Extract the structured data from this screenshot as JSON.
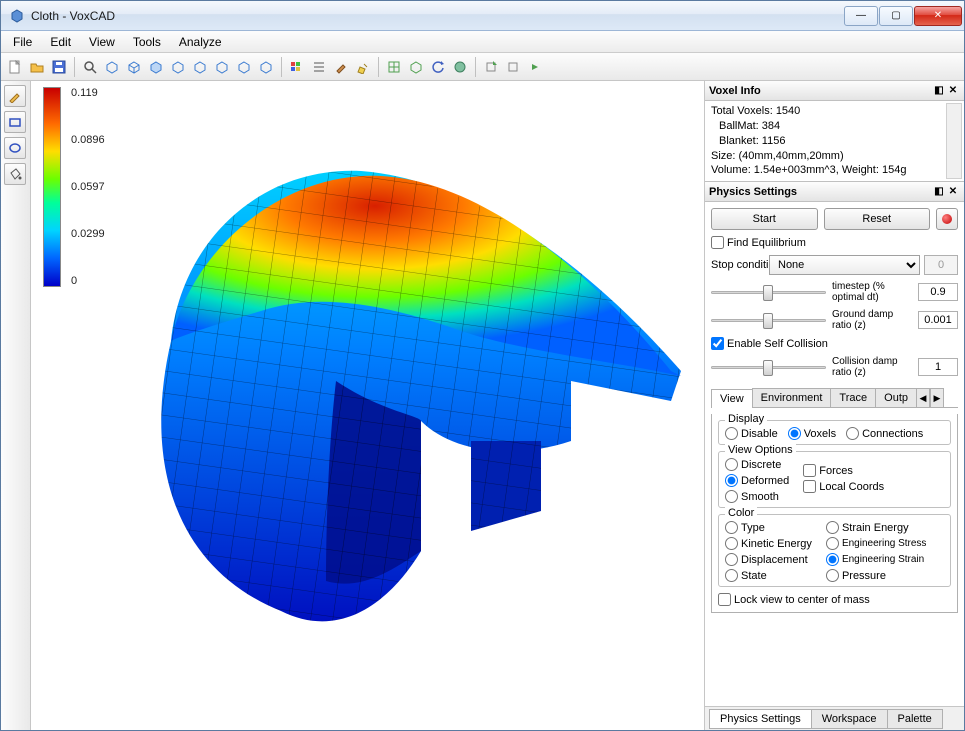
{
  "window": {
    "title": "Cloth - VoxCAD"
  },
  "menu": {
    "file": "File",
    "edit": "Edit",
    "view": "View",
    "tools": "Tools",
    "analyze": "Analyze"
  },
  "legend": {
    "v0": "0.119",
    "v1": "0.0896",
    "v2": "0.0597",
    "v3": "0.0299",
    "v4": "0"
  },
  "voxinfo": {
    "title": "Voxel Info",
    "line1": "Total Voxels: 1540",
    "line2": "BallMat: 384",
    "line3": "Blanket: 1156",
    "line4": "Size: (40mm,40mm,20mm)",
    "line5": "Volume: 1.54e+003mm^3, Weight: 154g"
  },
  "physics": {
    "title": "Physics Settings",
    "start": "Start",
    "reset": "Reset",
    "findeq": "Find Equilibrium",
    "stopcond_lbl": "Stop condition",
    "stopcond_val": "None",
    "stopcond_num": "0",
    "timestep_lbl": "timestep (% optimal dt)",
    "timestep_val": "0.9",
    "grounddamp_lbl": "Ground damp ratio (z)",
    "grounddamp_val": "0.001",
    "selfcol": "Enable Self Collision",
    "coldamp_lbl": "Collision damp ratio (z)",
    "coldamp_val": "1",
    "tabs": {
      "view": "View",
      "env": "Environment",
      "trace": "Trace",
      "out": "Outp"
    },
    "display": {
      "title": "Display",
      "disable": "Disable",
      "voxels": "Voxels",
      "connections": "Connections"
    },
    "viewopts": {
      "title": "View Options",
      "discrete": "Discrete",
      "deformed": "Deformed",
      "smooth": "Smooth",
      "forces": "Forces",
      "localcoords": "Local Coords"
    },
    "color": {
      "title": "Color",
      "type": "Type",
      "kinetic": "Kinetic Energy",
      "displacement": "Displacement",
      "state": "State",
      "strainenergy": "Strain Energy",
      "engstress": "Engineering Stress",
      "engstrain": "Engineering Strain",
      "pressure": "Pressure"
    },
    "lockview": "Lock view to center of mass"
  },
  "bottomtabs": {
    "physics": "Physics Settings",
    "workspace": "Workspace",
    "palette": "Palette"
  }
}
